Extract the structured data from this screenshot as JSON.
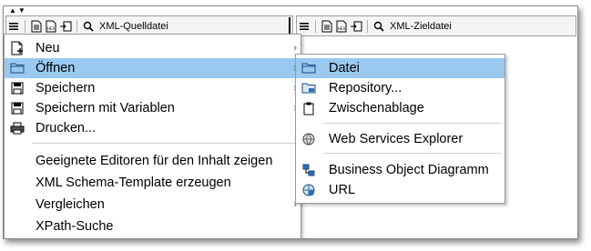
{
  "toolbar_left": {
    "label": "XML-Quelldatei"
  },
  "toolbar_right": {
    "label": "XML-Zieldatei"
  },
  "main_menu": {
    "items": [
      {
        "label": "Neu",
        "icon": "new-file-icon",
        "submenu": true
      },
      {
        "label": "Öffnen",
        "icon": "folder-icon",
        "submenu": true,
        "highlighted": true
      },
      {
        "label": "Speichern",
        "icon": "save-icon",
        "submenu": true
      },
      {
        "label": "Speichern mit Variablen",
        "icon": "save-icon",
        "submenu": true
      },
      {
        "label": "Drucken...",
        "icon": "printer-icon",
        "submenu": false
      },
      {
        "label": "Geeignete Editoren für den Inhalt zeigen",
        "icon": "",
        "submenu": false
      },
      {
        "label": "XML Schema-Template erzeugen",
        "icon": "",
        "submenu": false
      },
      {
        "label": "Vergleichen",
        "icon": "",
        "submenu": true
      },
      {
        "label": "XPath-Suche",
        "icon": "",
        "submenu": false
      }
    ]
  },
  "sub_menu": {
    "items": [
      {
        "label": "Datei",
        "icon": "folder-icon",
        "highlighted": true
      },
      {
        "label": "Repository...",
        "icon": "repository-icon"
      },
      {
        "label": "Zwischenablage",
        "icon": "clipboard-icon"
      },
      {
        "label": "Web Services Explorer",
        "icon": "globe-icon"
      },
      {
        "label": "Business Object Diagramm",
        "icon": "diagram-icon"
      },
      {
        "label": "URL",
        "icon": "url-icon"
      }
    ]
  },
  "colors": {
    "highlight": "#99c9ef",
    "border": "#9a9a9a"
  }
}
